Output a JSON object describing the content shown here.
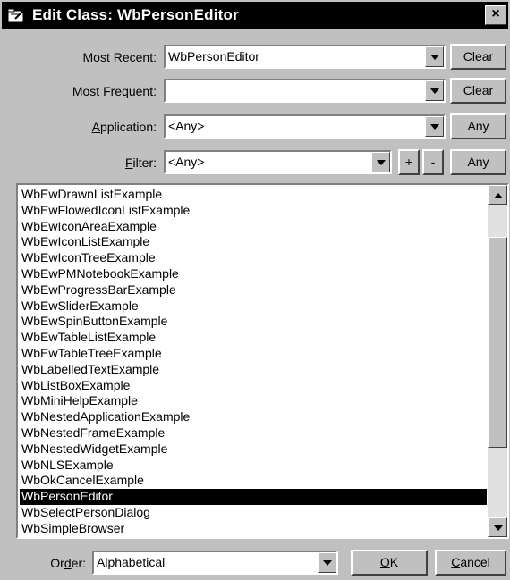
{
  "window": {
    "title": "Edit Class: WbPersonEditor",
    "close_glyph": "×"
  },
  "form": {
    "most_recent": {
      "label_pre": "Most ",
      "label_key": "R",
      "label_post": "ecent:",
      "value": "WbPersonEditor",
      "button": "Clear"
    },
    "most_frequent": {
      "label_pre": "Most ",
      "label_key": "F",
      "label_post": "requent:",
      "value": "",
      "button": "Clear"
    },
    "application": {
      "label_pre": "",
      "label_key": "A",
      "label_post": "pplication:",
      "value": "<Any>",
      "button": "Any"
    },
    "filter": {
      "label_pre": "",
      "label_key": "F",
      "label_post": "ilter:",
      "value": "<Any>",
      "plus": "+",
      "minus": "-",
      "button": "Any"
    }
  },
  "list": {
    "items": [
      "WbEwDrawnListExample",
      "WbEwFlowedIconListExample",
      "WbEwIconAreaExample",
      "WbEwIconListExample",
      "WbEwIconTreeExample",
      "WbEwPMNotebookExample",
      "WbEwProgressBarExample",
      "WbEwSliderExample",
      "WbEwSpinButtonExample",
      "WbEwTableListExample",
      "WbEwTableTreeExample",
      "WbLabelledTextExample",
      "WbListBoxExample",
      "WbMiniHelpExample",
      "WbNestedApplicationExample",
      "WbNestedFrameExample",
      "WbNestedWidgetExample",
      "WbNLSExample",
      "WbOkCancelExample",
      "WbPersonEditor",
      "WbSelectPersonDialog",
      "WbSimpleBrowser"
    ],
    "selected": "WbPersonEditor"
  },
  "footer": {
    "order_label_pre": "Or",
    "order_label_key": "d",
    "order_label_post": "er:",
    "order_value": "Alphabetical",
    "ok_key": "O",
    "ok_rest": "K",
    "cancel_key": "C",
    "cancel_rest": "ancel"
  }
}
